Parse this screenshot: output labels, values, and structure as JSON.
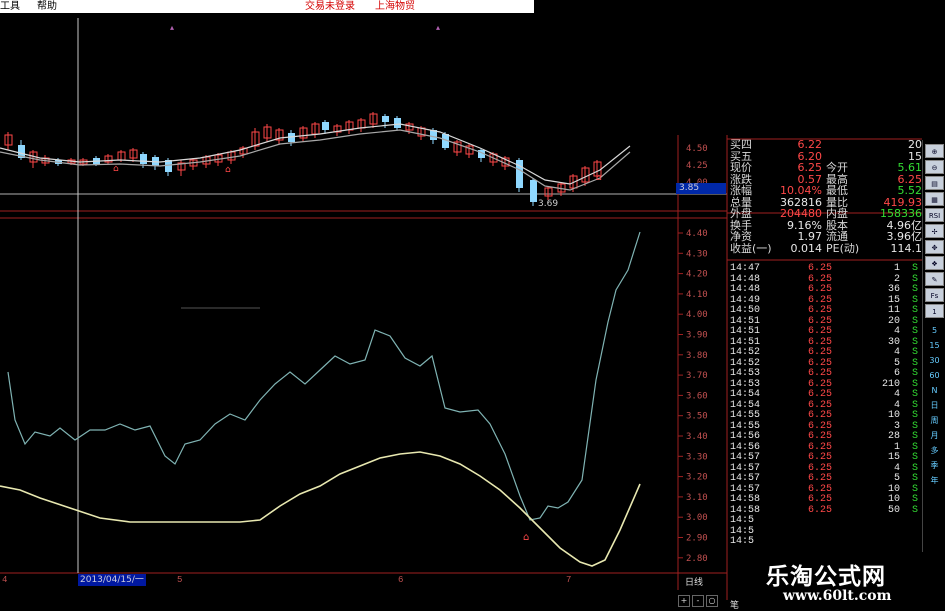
{
  "menu": {
    "tools": "工具",
    "help": "帮助",
    "trade_login": "交易未登录",
    "stock_name": "上海物贸"
  },
  "price_axis": {
    "upper": [
      "4.50",
      "4.25",
      "4.00"
    ],
    "lower": [
      "4.40",
      "4.30",
      "4.20",
      "4.10",
      "4.00",
      "3.90",
      "3.80",
      "3.70",
      "3.60",
      "3.50",
      "3.40",
      "3.30",
      "3.20",
      "3.10",
      "3.00",
      "2.90",
      "2.80"
    ]
  },
  "crosshair_price": "3.85",
  "min_label": "3.69",
  "quote": [
    {
      "l1": "买四",
      "v1": "6.22",
      "v1c": "red",
      "v2": "20",
      "v2c": "wht"
    },
    {
      "l1": "买五",
      "v1": "6.20",
      "v1c": "red",
      "v2": "15",
      "v2c": "wht"
    },
    {
      "l1": "现价",
      "v1": "6.25",
      "v1c": "red",
      "l2": "今开",
      "v2": "5.61",
      "v2c": "grn"
    },
    {
      "l1": "涨跌",
      "v1": "0.57",
      "v1c": "red",
      "l2": "最高",
      "v2": "6.25",
      "v2c": "red"
    },
    {
      "l1": "涨幅",
      "v1": "10.04%",
      "v1c": "red",
      "l2": "最低",
      "v2": "5.52",
      "v2c": "grn"
    },
    {
      "l1": "总量",
      "v1": "362816",
      "v1c": "wht",
      "l2": "量比",
      "v2": "419.93",
      "v2c": "red"
    },
    {
      "l1": "外盘",
      "v1": "204480",
      "v1c": "red",
      "l2": "内盘",
      "v2": "158336",
      "v2c": "grn"
    },
    {
      "l1": "换手",
      "v1": "9.16%",
      "v1c": "wht",
      "l2": "股本",
      "v2": "4.96亿",
      "v2c": "wht"
    },
    {
      "l1": "净资",
      "v1": "1.97",
      "v1c": "wht",
      "l2": "流通",
      "v2": "3.96亿",
      "v2c": "wht"
    },
    {
      "l1": "收益(一)",
      "v1": "0.014",
      "v1c": "wht",
      "l2": "PE(动)",
      "v2": "114.1",
      "v2c": "wht"
    }
  ],
  "ticks": [
    {
      "t": "14:47",
      "p": "6.25",
      "v": "1",
      "s": "S"
    },
    {
      "t": "14:48",
      "p": "6.25",
      "v": "2",
      "s": "S"
    },
    {
      "t": "14:48",
      "p": "6.25",
      "v": "36",
      "s": "S"
    },
    {
      "t": "14:49",
      "p": "6.25",
      "v": "15",
      "s": "S"
    },
    {
      "t": "14:50",
      "p": "6.25",
      "v": "11",
      "s": "S"
    },
    {
      "t": "14:51",
      "p": "6.25",
      "v": "20",
      "s": "S"
    },
    {
      "t": "14:51",
      "p": "6.25",
      "v": "4",
      "s": "S"
    },
    {
      "t": "14:51",
      "p": "6.25",
      "v": "30",
      "s": "S"
    },
    {
      "t": "14:52",
      "p": "6.25",
      "v": "4",
      "s": "S"
    },
    {
      "t": "14:52",
      "p": "6.25",
      "v": "5",
      "s": "S"
    },
    {
      "t": "14:53",
      "p": "6.25",
      "v": "6",
      "s": "S"
    },
    {
      "t": "14:53",
      "p": "6.25",
      "v": "210",
      "s": "S"
    },
    {
      "t": "14:54",
      "p": "6.25",
      "v": "4",
      "s": "S"
    },
    {
      "t": "14:54",
      "p": "6.25",
      "v": "4",
      "s": "S"
    },
    {
      "t": "14:55",
      "p": "6.25",
      "v": "10",
      "s": "S"
    },
    {
      "t": "14:55",
      "p": "6.25",
      "v": "3",
      "s": "S"
    },
    {
      "t": "14:56",
      "p": "6.25",
      "v": "28",
      "s": "S"
    },
    {
      "t": "14:56",
      "p": "6.25",
      "v": "1",
      "s": "S"
    },
    {
      "t": "14:57",
      "p": "6.25",
      "v": "15",
      "s": "S"
    },
    {
      "t": "14:57",
      "p": "6.25",
      "v": "4",
      "s": "S"
    },
    {
      "t": "14:57",
      "p": "6.25",
      "v": "5",
      "s": "S"
    },
    {
      "t": "14:57",
      "p": "6.25",
      "v": "10",
      "s": "S"
    },
    {
      "t": "14:58",
      "p": "6.25",
      "v": "10",
      "s": "S"
    },
    {
      "t": "14:58",
      "p": "6.25",
      "v": "50",
      "s": "S"
    },
    {
      "t": "14:5",
      "p": "",
      "v": "",
      "s": ""
    },
    {
      "t": "14:5",
      "p": "",
      "v": "",
      "s": ""
    },
    {
      "t": "14:5",
      "p": "",
      "v": "",
      "s": ""
    }
  ],
  "toolbar": {
    "icons": [
      "zoom-in-icon",
      "zoom-out-icon",
      "chart-icon",
      "table-icon",
      "rsi-icon",
      "compass-icon",
      "move-icon",
      "help-icon",
      "pen-icon",
      "fs-icon",
      "one-icon"
    ],
    "rsi": "RSI",
    "fs": "Fs",
    "one": "1",
    "periods": [
      "5",
      "15",
      "30",
      "60",
      "N",
      "日",
      "周",
      "月",
      "多",
      "季",
      "年"
    ]
  },
  "bottom": {
    "date": "2013/04/15/一",
    "marks": [
      "4",
      "5",
      "6",
      "7"
    ],
    "period": "日线",
    "buttons": [
      "+",
      "-",
      "○"
    ],
    "extra": "笔"
  },
  "watermark": {
    "title": "乐淘公式网",
    "url": "www.60lt.com"
  },
  "colors": {
    "up": "#ff4848",
    "down": "#33dd33",
    "axis": "#a02020",
    "grid": "#6a1a1a"
  }
}
